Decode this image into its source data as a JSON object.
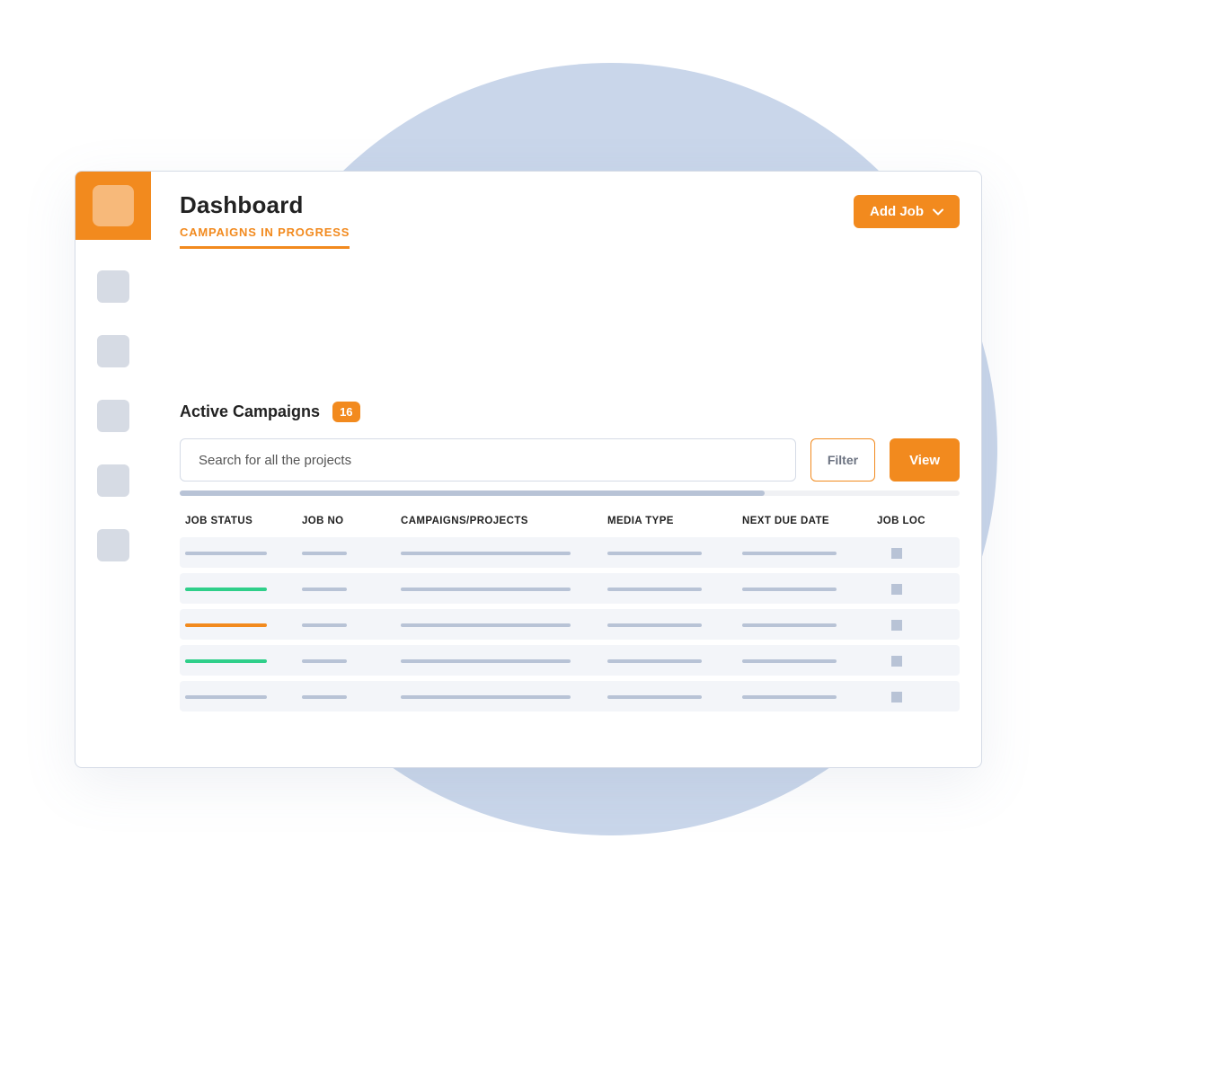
{
  "header": {
    "title": "Dashboard",
    "active_tab": "CAMPAIGNS IN PROGRESS",
    "add_job_label": "Add Job"
  },
  "section": {
    "title": "Active Campaigns",
    "count": "16"
  },
  "controls": {
    "search_placeholder": "Search for all the projects",
    "filter_label": "Filter",
    "view_label": "View"
  },
  "table": {
    "headers": [
      "JOB STATUS",
      "JOB NO",
      "CAMPAIGNS/PROJECTS",
      "MEDIA TYPE",
      "NEXT DUE DATE",
      "JOB LOC"
    ],
    "rows": [
      {
        "status_color": "gray"
      },
      {
        "status_color": "green"
      },
      {
        "status_color": "orange"
      },
      {
        "status_color": "green"
      },
      {
        "status_color": "gray"
      }
    ]
  },
  "colors": {
    "accent": "#f28a1e",
    "bg_circle": "#c9d6ea",
    "muted": "#b8c3d6",
    "green": "#2fcf8a"
  }
}
